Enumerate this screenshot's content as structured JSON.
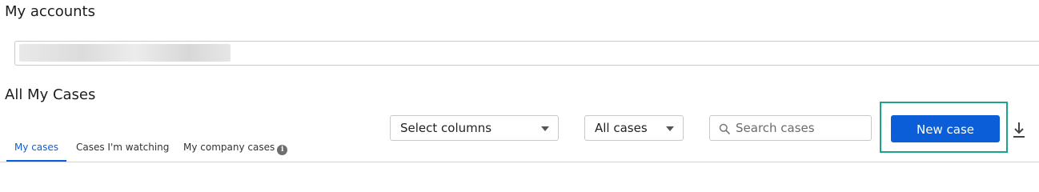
{
  "accounts": {
    "title": "My accounts"
  },
  "cases": {
    "title": "All My Cases",
    "tabs": [
      {
        "label": "My cases",
        "active": true
      },
      {
        "label": "Cases I'm watching",
        "active": false
      },
      {
        "label": "My company cases",
        "active": false,
        "icon": "info-icon"
      }
    ]
  },
  "toolbar": {
    "columns_select": "Select columns",
    "filter_select": "All cases",
    "search_placeholder": "Search cases",
    "new_case_label": "New case",
    "download_icon": "download-icon"
  },
  "colors": {
    "primary": "#0b5ed7",
    "highlight": "#1aa58a",
    "border": "#c9c9c9"
  }
}
